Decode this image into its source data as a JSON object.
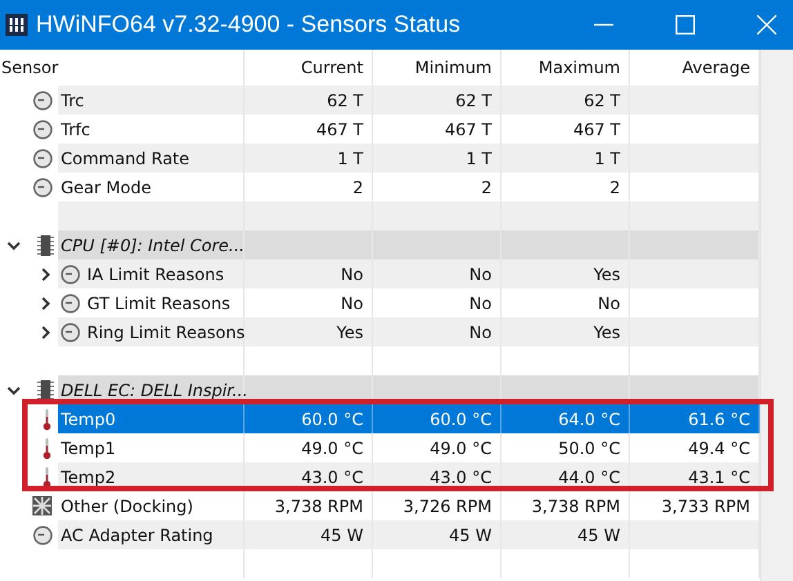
{
  "window": {
    "title": "HWiNFO64 v7.32-4900 - Sensors Status"
  },
  "table": {
    "columns": [
      "Sensor",
      "Current",
      "Minimum",
      "Maximum",
      "Average"
    ],
    "rows": [
      {
        "kind": "timing",
        "name": "Trc",
        "values": [
          "62 T",
          "62 T",
          "62 T"
        ],
        "selected": false,
        "highlighted": false
      },
      {
        "kind": "timing",
        "name": "Trfc",
        "values": [
          "467 T",
          "467 T",
          "467 T"
        ],
        "selected": false,
        "highlighted": false
      },
      {
        "kind": "timing",
        "name": "Command Rate",
        "values": [
          "1 T",
          "1 T",
          "1 T"
        ],
        "selected": false,
        "highlighted": false
      },
      {
        "kind": "timing",
        "name": "Gear Mode",
        "values": [
          "2",
          "2",
          "2"
        ],
        "selected": false,
        "highlighted": false
      },
      {
        "kind": "blank"
      },
      {
        "kind": "group",
        "name": "CPU [#0]: Intel Core...",
        "expanded": true,
        "children": [
          {
            "kind": "limit",
            "name": "IA Limit Reasons",
            "values": [
              "No",
              "No",
              "Yes"
            ],
            "expanded": false,
            "selected": false,
            "highlighted": false
          },
          {
            "kind": "limit",
            "name": "GT Limit Reasons",
            "values": [
              "No",
              "No",
              "No"
            ],
            "expanded": false,
            "selected": false,
            "highlighted": false
          },
          {
            "kind": "limit",
            "name": "Ring Limit Reasons",
            "values": [
              "Yes",
              "No",
              "Yes"
            ],
            "expanded": false,
            "selected": false,
            "highlighted": false
          },
          {
            "kind": "blank"
          }
        ]
      },
      {
        "kind": "group",
        "name": "DELL EC: DELL Inspir...",
        "expanded": true,
        "children": [
          {
            "kind": "temperature",
            "name": "Temp0",
            "values": [
              "60.0 °C",
              "60.0 °C",
              "64.0 °C",
              "61.6 °C"
            ],
            "selected": true,
            "highlighted": true
          },
          {
            "kind": "temperature",
            "name": "Temp1",
            "values": [
              "49.0 °C",
              "49.0 °C",
              "50.0 °C",
              "49.4 °C"
            ],
            "selected": false,
            "highlighted": true
          },
          {
            "kind": "temperature",
            "name": "Temp2",
            "values": [
              "43.0 °C",
              "43.0 °C",
              "44.0 °C",
              "43.1 °C"
            ],
            "selected": false,
            "highlighted": true
          },
          {
            "kind": "fan",
            "name": "Other (Docking)",
            "values": [
              "3,738 RPM",
              "3,726 RPM",
              "3,738 RPM",
              "3,733 RPM"
            ],
            "selected": false,
            "highlighted": false
          },
          {
            "kind": "power",
            "name": "AC Adapter Rating",
            "values": [
              "45 W",
              "45 W",
              "45 W"
            ],
            "selected": false,
            "highlighted": false
          },
          {
            "kind": "blank"
          }
        ]
      }
    ]
  }
}
